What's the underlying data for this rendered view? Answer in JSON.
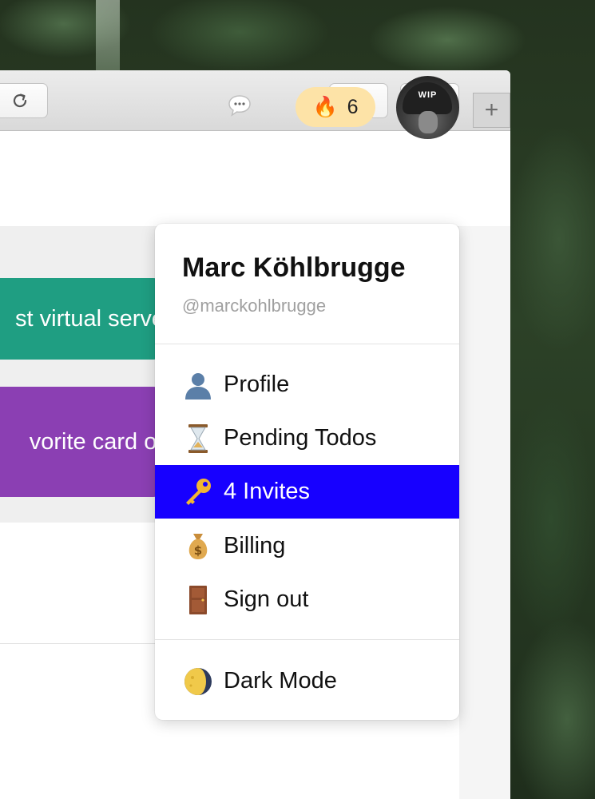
{
  "header": {
    "streak_count": "6"
  },
  "avatar": {
    "badge_text": "WIP"
  },
  "cards": {
    "green_text": "st virtual serve",
    "purple_text": "vorite card or"
  },
  "user": {
    "name": "Marc Köhlbrugge",
    "handle": "@marckohlbrugge"
  },
  "menu": {
    "items": [
      {
        "icon": "person-icon",
        "label": "Profile"
      },
      {
        "icon": "hourglass-icon",
        "label": "Pending Todos"
      },
      {
        "icon": "key-icon",
        "label": "4 Invites"
      },
      {
        "icon": "money-bag-icon",
        "label": "Billing"
      },
      {
        "icon": "door-icon",
        "label": "Sign out"
      },
      {
        "icon": "moon-icon",
        "label": "Dark Mode"
      }
    ],
    "active_index": 2
  },
  "colors": {
    "active_item": "#1700ff",
    "streak_badge": "#fde3a7",
    "green_card": "#1f9e82",
    "purple_card": "#8b3fb3"
  }
}
